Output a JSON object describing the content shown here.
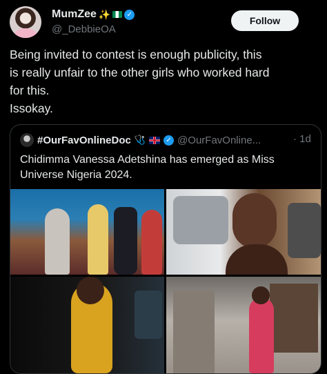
{
  "author": {
    "display_name": "MumZee",
    "emojis": "✨",
    "handle": "@_DebbieOA"
  },
  "follow_label": "Follow",
  "tweet_text": "Being invited to contest is enough publicity, this\nis really unfair to the other girls who worked hard\nfor this.\nIssokay.",
  "quoted": {
    "display_name": "#OurFavOnlineDoc",
    "stetho": "🩺",
    "handle": "@OurFavOnline...",
    "time": "· 1d",
    "text": "Chidimma Vanessa Adetshina has emerged as Miss\nUniverse Nigeria 2024.",
    "media": [
      {
        "name": "crowning-photo"
      },
      {
        "name": "selfie-photo"
      },
      {
        "name": "gold-gown-photo"
      },
      {
        "name": "red-dress-photo"
      }
    ]
  },
  "colors": {
    "background": "#000000",
    "text": "#e7e9ea",
    "muted": "#71767b",
    "verified": "#1d9bf0",
    "border": "#2f3336"
  }
}
